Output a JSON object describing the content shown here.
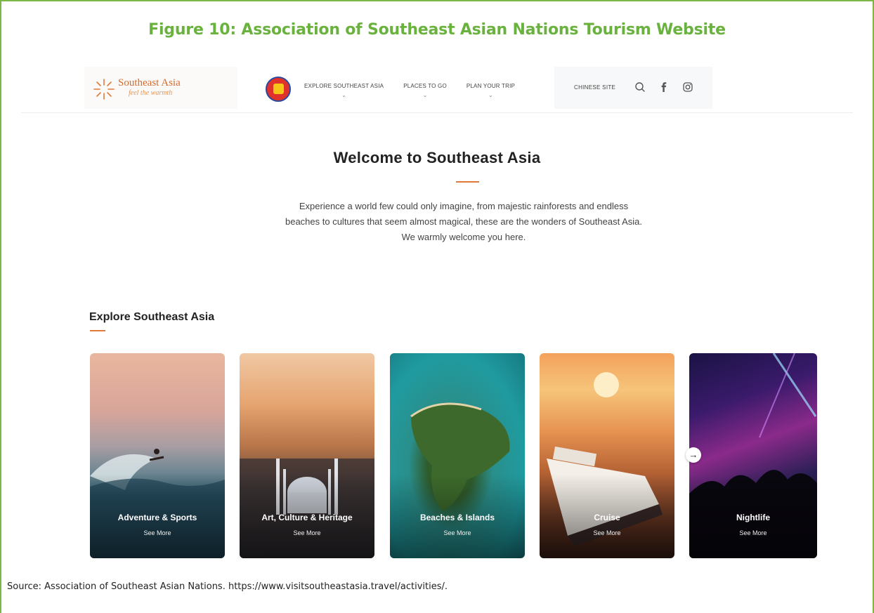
{
  "figure": {
    "title": "Figure 10: Association of Southeast Asian Nations Tourism Website",
    "source": "Source: Association of Southeast Asian Nations. https://www.visitsoutheastasia.travel/activities/."
  },
  "header": {
    "logo_text": "Southeast Asia",
    "logo_tagline": "feel the warmth",
    "nav": [
      {
        "label": "EXPLORE SOUTHEAST ASIA"
      },
      {
        "label": "PLACES TO GO"
      },
      {
        "label": "PLAN YOUR TRIP"
      }
    ],
    "chinese_site": "CHINESE SITE",
    "icons": [
      "search-icon",
      "facebook-icon",
      "instagram-icon"
    ]
  },
  "welcome": {
    "title": "Welcome to Southeast Asia",
    "lines": [
      "Experience a world few could only imagine, from majestic rainforests and endless",
      "beaches to cultures that seem almost magical, these are the wonders of Southeast Asia.",
      "We warmly welcome you here."
    ]
  },
  "explore": {
    "title": "Explore Southeast Asia",
    "cards": [
      {
        "label": "Adventure & Sports",
        "more": "See More"
      },
      {
        "label": "Art, Culture & Heritage",
        "more": "See More"
      },
      {
        "label": "Beaches & Islands",
        "more": "See More"
      },
      {
        "label": "Cruise",
        "more": "See More"
      },
      {
        "label": "Nightlife",
        "more": "See More"
      }
    ],
    "next_arrow": "→"
  },
  "colors": {
    "figure_green": "#6ab23e",
    "accent_orange": "#e07a3a"
  }
}
